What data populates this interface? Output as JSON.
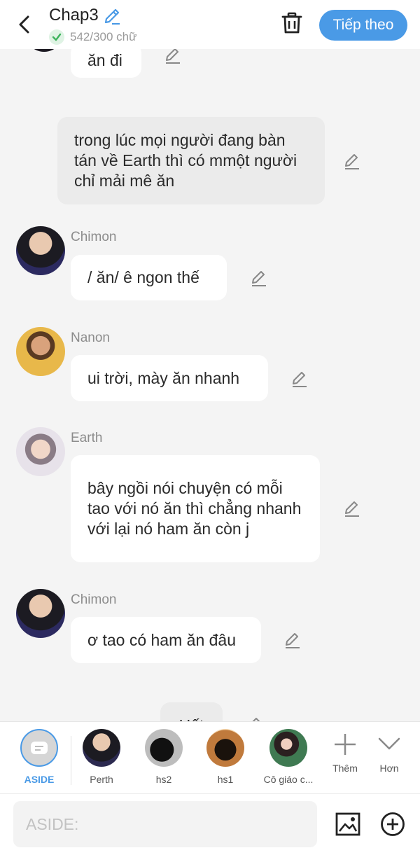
{
  "header": {
    "title": "Chap3",
    "word_count": "542/300 chữ",
    "next_label": "Tiếp theo"
  },
  "messages": {
    "m0": {
      "text": "ăn đi"
    },
    "m1": {
      "text": "trong lúc mọi người đang bàn tán về Earth thì có mmột người  chỉ mải mê ăn"
    },
    "m2": {
      "name": "Chimon",
      "text": "/ ăn/ ê ngon thế"
    },
    "m3": {
      "name": "Nanon",
      "text": "ui trời,  mày ăn nhanh"
    },
    "m4": {
      "name": "Earth",
      "text": "bây ngồi nói chuyện  có mỗi tao với nó ăn thì chẳng nhanh với lại nó ham ăn còn j"
    },
    "m5": {
      "name": "Chimon",
      "text": "ơ tao có ham ăn đâu"
    },
    "m6": {
      "text": "Hết"
    }
  },
  "characters": {
    "aside": "ASIDE",
    "perth": "Perth",
    "hs2": "hs2",
    "hs1": "hs1",
    "teacher": "Cô giáo c...",
    "more": "Thêm",
    "less": "Hơn"
  },
  "input": {
    "placeholder": "ASIDE:"
  },
  "colors": {
    "accent": "#4a9ae6",
    "background": "#f4f4f4",
    "aside_bubble": "#ebebeb",
    "check": "#3cb35b"
  }
}
